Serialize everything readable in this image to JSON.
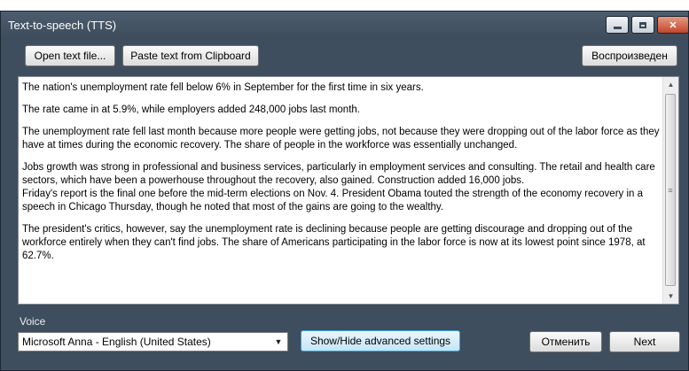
{
  "window": {
    "title": "Text-to-speech (TTS)",
    "close_glyph": "✕"
  },
  "toolbar": {
    "open_label": "Open text file...",
    "paste_label": "Paste text from Clipboard",
    "play_label": "Воспроизведен"
  },
  "text": {
    "paragraphs": [
      "The nation's unemployment rate fell below 6% in September for the first time in six years.",
      "The rate came in at 5.9%, while employers added 248,000 jobs last month.",
      "The unemployment rate fell last month because more people were getting jobs, not because they were dropping out of the labor force as they have at times during the economic recovery. The share of people in the workforce was essentially unchanged.",
      "Jobs growth was strong in professional and business services, particularly in employment services and consulting. The retail and health care sectors, which have been a powerhouse throughout the recovery, also gained. Construction added 16,000 jobs.",
      "Friday's report is the final one before the mid-term elections on Nov. 4. President Obama touted the strength of the economy recovery in a speech in Chicago Thursday, though he noted that most of the gains are going to the wealthy.",
      "The president's critics, however, say the unemployment rate is declining because people are getting discourage and dropping out of the workforce entirely when they can't find jobs. The share of Americans participating in the labor force is now at its lowest point since 1978, at 62.7%."
    ]
  },
  "voice": {
    "label": "Voice",
    "selected": "Microsoft Anna - English (United States)"
  },
  "footer": {
    "advanced_label": "Show/Hide advanced settings",
    "cancel_label": "Отменить",
    "next_label": "Next"
  },
  "icons": {
    "minimize": "minimize-icon",
    "maximize": "maximize-icon",
    "close": "close-icon",
    "scroll_up": "scroll-up-icon",
    "scroll_down": "scroll-down-icon",
    "dropdown": "chevron-down-icon"
  },
  "colors": {
    "window_bg": "#3f4e5e",
    "close_button": "#c3452b",
    "highlight_button": "#c4e5f6"
  }
}
